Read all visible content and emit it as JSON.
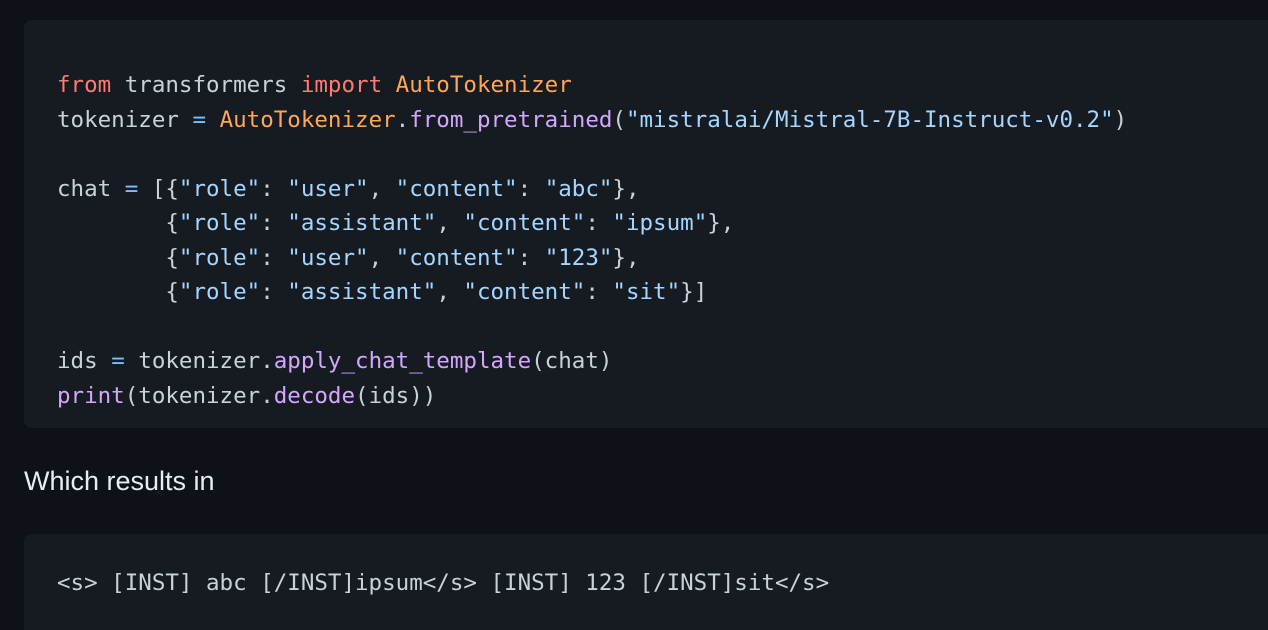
{
  "code_block_1": {
    "language": "python",
    "colors": {
      "keyword": "#ff7b72",
      "class": "#ffa657",
      "function": "#d2a8ff",
      "string": "#a5d6ff",
      "operator": "#79c0ff",
      "text": "#c9d1d9",
      "background": "#161b22"
    },
    "lines": [
      [
        {
          "t": "from",
          "k": "kw"
        },
        {
          "t": " transformers ",
          "k": "tx"
        },
        {
          "t": "import",
          "k": "kw"
        },
        {
          "t": " ",
          "k": "tx"
        },
        {
          "t": "AutoTokenizer",
          "k": "cls"
        }
      ],
      [
        {
          "t": "tokenizer ",
          "k": "tx"
        },
        {
          "t": "=",
          "k": "op"
        },
        {
          "t": " ",
          "k": "tx"
        },
        {
          "t": "AutoTokenizer",
          "k": "cls"
        },
        {
          "t": ".",
          "k": "tx"
        },
        {
          "t": "from_pretrained",
          "k": "fn"
        },
        {
          "t": "(",
          "k": "tx"
        },
        {
          "t": "\"mistralai/Mistral-7B-Instruct-v0.2\"",
          "k": "str"
        },
        {
          "t": ")",
          "k": "tx"
        }
      ],
      [],
      [
        {
          "t": "chat ",
          "k": "tx"
        },
        {
          "t": "=",
          "k": "op"
        },
        {
          "t": " [{",
          "k": "tx"
        },
        {
          "t": "\"role\"",
          "k": "str"
        },
        {
          "t": ": ",
          "k": "tx"
        },
        {
          "t": "\"user\"",
          "k": "str"
        },
        {
          "t": ", ",
          "k": "tx"
        },
        {
          "t": "\"content\"",
          "k": "str"
        },
        {
          "t": ": ",
          "k": "tx"
        },
        {
          "t": "\"abc\"",
          "k": "str"
        },
        {
          "t": "},",
          "k": "tx"
        }
      ],
      [
        {
          "t": "        {",
          "k": "tx"
        },
        {
          "t": "\"role\"",
          "k": "str"
        },
        {
          "t": ": ",
          "k": "tx"
        },
        {
          "t": "\"assistant\"",
          "k": "str"
        },
        {
          "t": ", ",
          "k": "tx"
        },
        {
          "t": "\"content\"",
          "k": "str"
        },
        {
          "t": ": ",
          "k": "tx"
        },
        {
          "t": "\"ipsum\"",
          "k": "str"
        },
        {
          "t": "},",
          "k": "tx"
        }
      ],
      [
        {
          "t": "        {",
          "k": "tx"
        },
        {
          "t": "\"role\"",
          "k": "str"
        },
        {
          "t": ": ",
          "k": "tx"
        },
        {
          "t": "\"user\"",
          "k": "str"
        },
        {
          "t": ", ",
          "k": "tx"
        },
        {
          "t": "\"content\"",
          "k": "str"
        },
        {
          "t": ": ",
          "k": "tx"
        },
        {
          "t": "\"123\"",
          "k": "str"
        },
        {
          "t": "},",
          "k": "tx"
        }
      ],
      [
        {
          "t": "        {",
          "k": "tx"
        },
        {
          "t": "\"role\"",
          "k": "str"
        },
        {
          "t": ": ",
          "k": "tx"
        },
        {
          "t": "\"assistant\"",
          "k": "str"
        },
        {
          "t": ", ",
          "k": "tx"
        },
        {
          "t": "\"content\"",
          "k": "str"
        },
        {
          "t": ": ",
          "k": "tx"
        },
        {
          "t": "\"sit\"",
          "k": "str"
        },
        {
          "t": "}]",
          "k": "tx"
        }
      ],
      [],
      [
        {
          "t": "ids ",
          "k": "tx"
        },
        {
          "t": "=",
          "k": "op"
        },
        {
          "t": " tokenizer.",
          "k": "tx"
        },
        {
          "t": "apply_chat_template",
          "k": "fn"
        },
        {
          "t": "(chat)",
          "k": "tx"
        }
      ],
      [
        {
          "t": "print",
          "k": "fn"
        },
        {
          "t": "(tokenizer.",
          "k": "tx"
        },
        {
          "t": "decode",
          "k": "fn"
        },
        {
          "t": "(ids))",
          "k": "tx"
        }
      ]
    ]
  },
  "prose": {
    "text": "Which results in"
  },
  "code_block_2": {
    "text": "<s> [INST] abc [/INST]ipsum</s> [INST] 123 [/INST]sit</s>"
  }
}
